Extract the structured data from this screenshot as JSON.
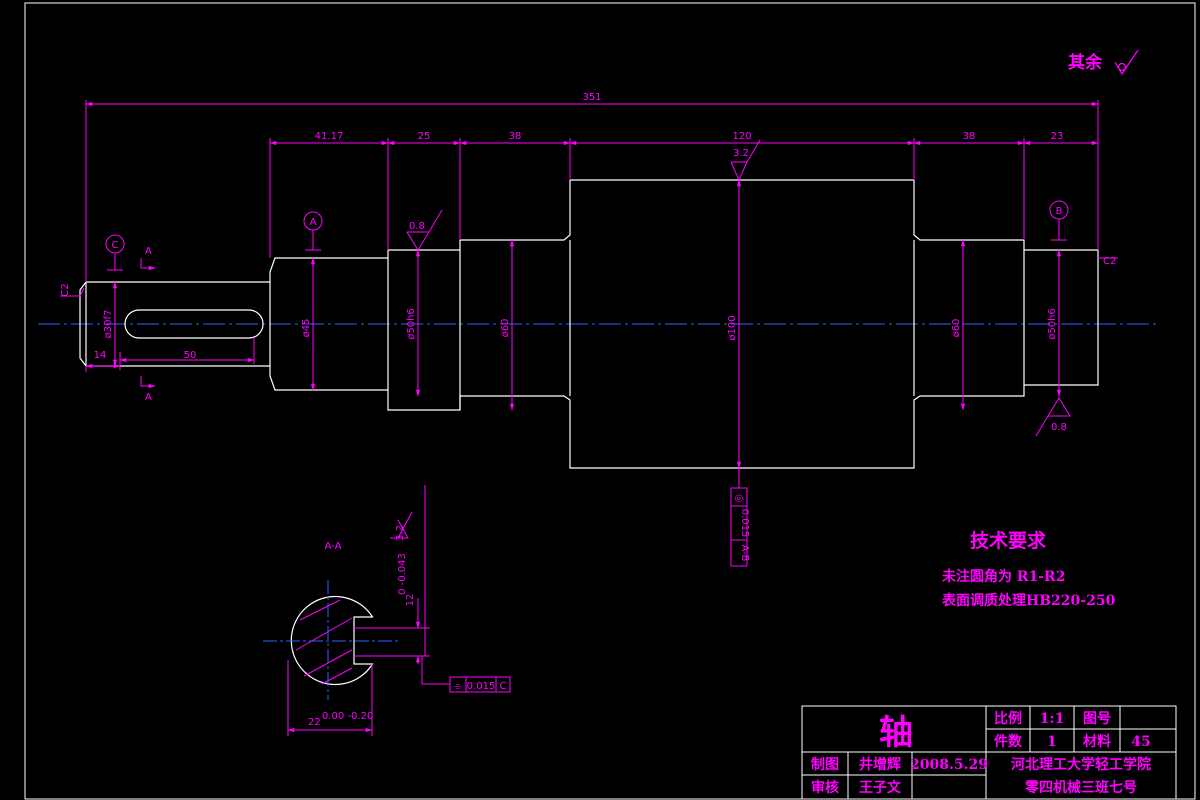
{
  "colors": {
    "background": "#000000",
    "outline": "#ffffff",
    "dimension": "#ff00ff",
    "centerline": "#0000ff"
  },
  "roughness_note": {
    "label": "其余"
  },
  "dimensions": {
    "overall_length": "351",
    "seg_41_17": "41.17",
    "seg_25": "25",
    "seg_38_left": "38",
    "seg_120": "120",
    "seg_38_right": "38",
    "seg_23": "23",
    "keyway_len": "50",
    "keyway_offset": "14",
    "dia_30": "ø30f7",
    "dia_45": "ø45",
    "dia_50_left": "ø50h6",
    "dia_60_left": "ø60",
    "dia_100": "ø100",
    "dia_60_right": "ø60",
    "dia_50_right": "ø50h6",
    "chamfer_left": "C2",
    "chamfer_right": "C2"
  },
  "roughness": {
    "r1": "0.8",
    "r2": "3.2",
    "r3": "0.8",
    "r4": "3.2"
  },
  "datums": {
    "a": "A",
    "b": "B",
    "c": "C"
  },
  "section": {
    "marker": "A",
    "title": "A-A",
    "depth_dim": "12",
    "depth_tol": "0 -0.043",
    "width_dim": "22",
    "width_tol": "0.00 -0.20"
  },
  "tolerance_runout": {
    "symbol": "◎",
    "value": "0.015",
    "datum": "A-B"
  },
  "tolerance_sym": {
    "symbol": "⌯",
    "value": "0.015",
    "datum": "C"
  },
  "tech_req": {
    "title": "技术要求",
    "line1": "未注圆角为 R1-R2",
    "line2": "表面调质处理HB220-250"
  },
  "title_block": {
    "part_name": "轴",
    "scale_label": "比例",
    "scale_value": "1:1",
    "drawing_no_label": "图号",
    "qty_label": "件数",
    "qty_value": "1",
    "material_label": "材料",
    "material_value": "45",
    "drawn_label": "制图",
    "drawn_name": "井增辉",
    "date": "2008.5.29",
    "checked_label": "审核",
    "checked_name": "王子文",
    "school": "河北理工大学轻工学院",
    "class": "零四机械三班七号"
  }
}
